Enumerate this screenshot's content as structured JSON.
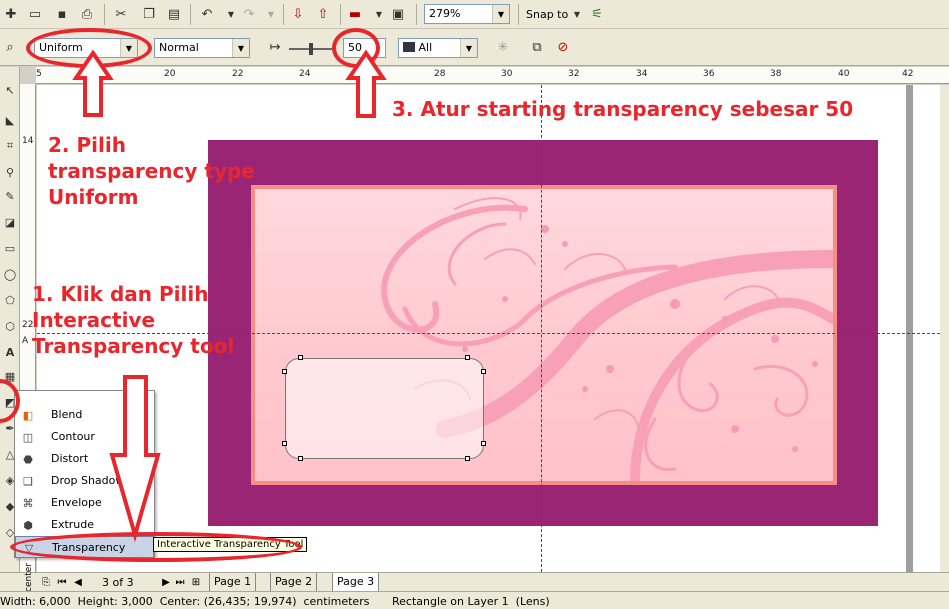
{
  "toolbar": {
    "zoom": "279%",
    "snap_to": "Snap to",
    "icons": [
      "new-icon",
      "open-icon",
      "save-icon",
      "print-icon",
      "cut-icon",
      "copy-icon",
      "paste-icon",
      "undo-icon",
      "redo-icon",
      "import-icon",
      "export-icon",
      "application-launcher-icon",
      "welcome-screen-icon"
    ]
  },
  "property_bar": {
    "transparency_type": "Uniform",
    "merge_mode": "Normal",
    "starting_transparency": "50",
    "target": "All"
  },
  "ruler": {
    "top_ticks": [
      "5",
      "20",
      "22",
      "24",
      "26",
      "28",
      "30",
      "32",
      "34",
      "36",
      "38",
      "40",
      "42"
    ],
    "left_ticks": [
      "14",
      "22",
      "A"
    ]
  },
  "flyout": {
    "items": [
      {
        "label": "Blend",
        "icon": "blend-icon"
      },
      {
        "label": "Contour",
        "icon": "contour-icon"
      },
      {
        "label": "Distort",
        "icon": "distort-icon"
      },
      {
        "label": "Drop Shadow",
        "icon": "drop-shadow-icon"
      },
      {
        "label": "Envelope",
        "icon": "envelope-icon"
      },
      {
        "label": "Extrude",
        "icon": "extrude-icon"
      },
      {
        "label": "Transparency",
        "icon": "transparency-icon"
      }
    ],
    "tooltip": "Interactive Transparency Tool"
  },
  "pages": {
    "counter": "3 of 3",
    "tabs": [
      "Page 1",
      "Page 2",
      "Page 3"
    ],
    "active": "Page 3"
  },
  "status": {
    "left_text": "Width: 6,000  Height: 3,000  Center: (26,435; 19,974)  centimeters",
    "right_text": "Rectangle on Layer 1  (Lens)",
    "side_label": "center"
  },
  "annotations": {
    "step1": [
      "1. Klik dan Pilih",
      "Interactive",
      "Transparency tool"
    ],
    "step2": [
      "2. Pilih",
      "transparency type",
      "Uniform"
    ],
    "step3": "3. Atur starting transparency sebesar 50"
  },
  "colors": {
    "card_background": "#9a2574",
    "card_inner": "#ffcdd2",
    "card_border": "#f58e84",
    "annotation": "#e8262c",
    "guide": "#4b3aa0"
  }
}
